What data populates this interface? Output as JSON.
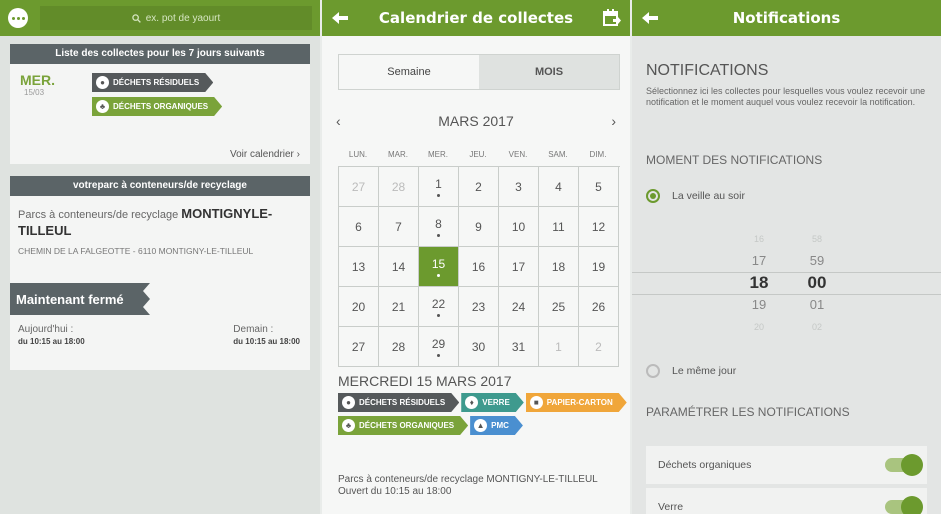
{
  "colors": {
    "accent": "#6c9a2e",
    "dark": "#5b6467",
    "residuels": "#55595b",
    "organiques": "#7aa33a",
    "verre": "#3e9a8e",
    "papier": "#f0a63a",
    "pmc": "#4a8fd0"
  },
  "panel1": {
    "search_placeholder": "ex. pot de yaourt",
    "collections_header": "Liste des collectes pour les 7 jours suivants",
    "day_name": "MER.",
    "day_date": "15/03",
    "day_tags": [
      {
        "label": "DÉCHETS RÉSIDUELS",
        "icon": "bag-icon"
      },
      {
        "label": "DÉCHETS ORGANIQUES",
        "icon": "leaf-icon"
      }
    ],
    "voir_calendrier": "Voir calendrier ›",
    "parc_header": "votreparc à conteneurs/de recyclage",
    "parc_prefix": "Parcs à conteneurs/de recyclage",
    "parc_name": "MONTIGNYLE-TILLEUL",
    "parc_address": "CHEMIN DE LA FALGEOTTE - 6110 MONTIGNY-LE-TILLEUL",
    "status": "Maintenant fermé",
    "today_label": "Aujourd'hui :",
    "today_hours": "du 10:15 au 18:00",
    "tomorrow_label": "Demain :",
    "tomorrow_hours": "du 10:15 au 18:00"
  },
  "panel2": {
    "title": "Calendrier de collectes",
    "tab_week": "Semaine",
    "tab_month": "MOIS",
    "prev": "‹",
    "next": "›",
    "month": "MARS 2017",
    "weekdays": [
      "LUN.",
      "MAR.",
      "MER.",
      "JEU.",
      "VEN.",
      "SAM.",
      "DIM."
    ],
    "weeks": [
      [
        {
          "d": "27",
          "other": true
        },
        {
          "d": "28",
          "other": true
        },
        {
          "d": "1",
          "dot": true
        },
        {
          "d": "2"
        },
        {
          "d": "3"
        },
        {
          "d": "4"
        },
        {
          "d": "5"
        }
      ],
      [
        {
          "d": "6"
        },
        {
          "d": "7"
        },
        {
          "d": "8",
          "dot": true
        },
        {
          "d": "9"
        },
        {
          "d": "10"
        },
        {
          "d": "11"
        },
        {
          "d": "12"
        }
      ],
      [
        {
          "d": "13"
        },
        {
          "d": "14"
        },
        {
          "d": "15",
          "dot": true,
          "sel": true
        },
        {
          "d": "16"
        },
        {
          "d": "17"
        },
        {
          "d": "18"
        },
        {
          "d": "19"
        }
      ],
      [
        {
          "d": "20"
        },
        {
          "d": "21"
        },
        {
          "d": "22",
          "dot": true
        },
        {
          "d": "23"
        },
        {
          "d": "24"
        },
        {
          "d": "25"
        },
        {
          "d": "26"
        }
      ],
      [
        {
          "d": "27"
        },
        {
          "d": "28"
        },
        {
          "d": "29",
          "dot": true
        },
        {
          "d": "30"
        },
        {
          "d": "31"
        },
        {
          "d": "1",
          "other": true
        },
        {
          "d": "2",
          "other": true
        }
      ]
    ],
    "selected_date": "MERCREDI 15 MARS 2017",
    "tags": [
      {
        "label": "DÉCHETS RÉSIDUELS",
        "cls": "t-res",
        "icon": "bag-icon"
      },
      {
        "label": "VERRE",
        "cls": "t-ver",
        "icon": "bottle-icon"
      },
      {
        "label": "PAPIER-CARTON",
        "cls": "t-pap",
        "icon": "paper-icon"
      },
      {
        "label": "DÉCHETS ORGANIQUES",
        "cls": "t-org",
        "icon": "leaf-icon"
      },
      {
        "label": "PMC",
        "cls": "t-pmc",
        "icon": "can-icon"
      }
    ],
    "parc_info": "Parcs à conteneurs/de recyclage MONTIGNY-LE-TILLEUL Ouvert du 10:15 au 18:00"
  },
  "panel3": {
    "title": "Notifications",
    "heading": "NOTIFICATIONS",
    "description": "Sélectionnez ici les collectes pour lesquelles vous voulez recevoir une notification et le moment auquel vous voulez recevoir la notification.",
    "moment_header": "MOMENT DES NOTIFICATIONS",
    "option_veille": "La veille au soir",
    "option_meme_jour": "Le même jour",
    "hours": [
      "16",
      "17",
      "18",
      "19",
      "20"
    ],
    "minutes": [
      "58",
      "59",
      "00",
      "01",
      "02"
    ],
    "params_header": "PARAMÉTRER LES NOTIFICATIONS",
    "toggles": [
      {
        "label": "Déchets organiques",
        "on": true
      },
      {
        "label": "Verre",
        "on": true
      }
    ]
  }
}
